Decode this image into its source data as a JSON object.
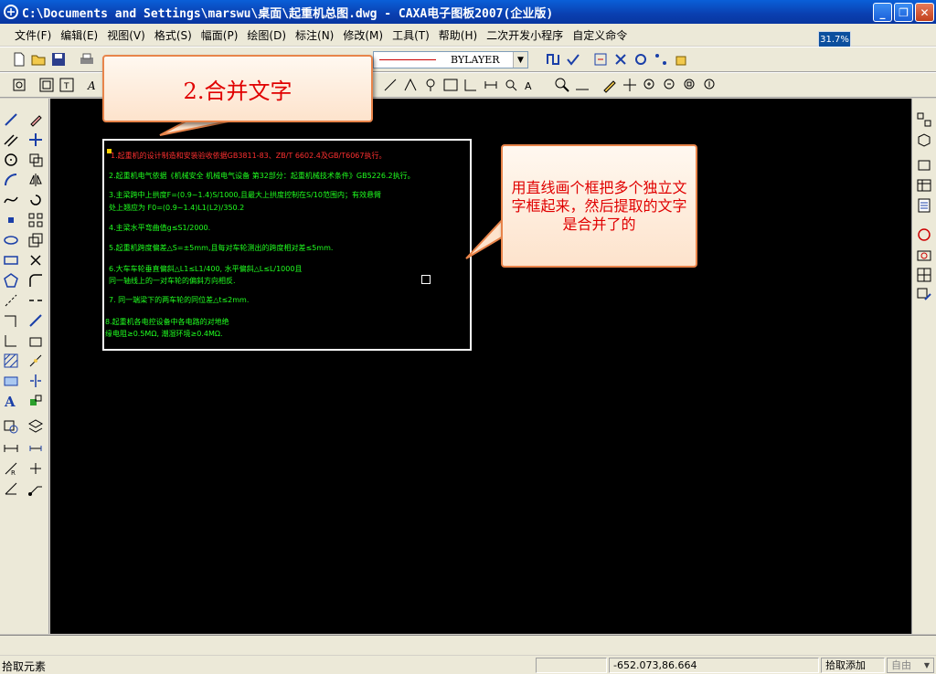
{
  "window": {
    "title": "C:\\Documents and Settings\\marswu\\桌面\\起重机总图.dwg - CAXA电子图板2007(企业版)",
    "buttons": [
      "_",
      "❐",
      "✕"
    ]
  },
  "menu": [
    "文件(F)",
    "编辑(E)",
    "视图(V)",
    "格式(S)",
    "幅面(P)",
    "绘图(D)",
    "标注(N)",
    "修改(M)",
    "工具(T)",
    "帮助(H)",
    "二次开发小程序",
    "自定义命令"
  ],
  "zoom_badge": "31.7%",
  "toolbar": {
    "layer_value": "BYLAYER"
  },
  "canvas": {
    "lines": [
      {
        "text": "1.起重机的设计制造和安装验收依据GB3811-83、ZB/T 6602.4及GB/T6067执行。",
        "color": "red"
      },
      {
        "text": "2.起重机电气依据《机械安全  机械电气设备 第32部分：起重机械技术条件》GB5226.2执行。",
        "color": "green"
      },
      {
        "text": "3.主梁跨中上拱度F=(0.9~1.4)S/1000,且最大上拱度控制在S/10范围内；有效悬臂",
        "color": "green"
      },
      {
        "text": "处上翘应为  F0=(0.9~1.4)L1(L2)/350.2",
        "color": "green"
      },
      {
        "text": "4.主梁水平弯曲值g≤S1/2000.",
        "color": "green"
      },
      {
        "text": "5.起重机跨度偏差△S=±5mm,且每对车轮测出的跨度相对差≤5mm.",
        "color": "green"
      },
      {
        "text": "6.大车车轮垂直偏斜△L1≤L1/400, 水平偏斜△L≤L/1000且",
        "color": "green"
      },
      {
        "text": "同一轴线上的一对车轮的偏斜方向相反.",
        "color": "green"
      },
      {
        "text": "7. 同一端梁下的两车轮的同位差△t≤2mm.",
        "color": "green"
      },
      {
        "text": "8.起重机各电控设备中各电路的对地绝",
        "color": "green"
      },
      {
        "text": "缘电阻≥0.5MΩ, 潮湿环境≥0.4MΩ.",
        "color": "green"
      }
    ]
  },
  "callouts": {
    "step": "2.合并文字",
    "note": "用直线画个框把多个独立文字框起来，然后提取的文字是合并了的"
  },
  "status": {
    "prompt": "拾取元素",
    "coords": "-652.073,86.664",
    "mode": "拾取添加",
    "select_value": "自由"
  }
}
